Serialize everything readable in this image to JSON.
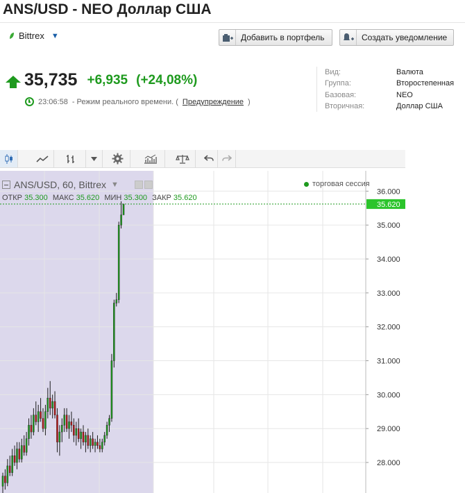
{
  "header": {
    "title": "ANS/USD - NEO Доллар США",
    "exchange": "Bittrex"
  },
  "actions": {
    "add_portfolio": "Добавить в портфель",
    "create_alert": "Создать уведомление"
  },
  "quote": {
    "price": "35,735",
    "change": "+6,935",
    "change_pct": "(+24,08%)",
    "time": "23:06:58",
    "mode_text": "- Режим реального времени. (",
    "warning_link": "Предупреждение",
    "mode_close": ")"
  },
  "info": [
    {
      "key": "Вид:",
      "value": "Валюта"
    },
    {
      "key": "Группа:",
      "value": "Второстепенная"
    },
    {
      "key": "Базовая:",
      "value": "NEO"
    },
    {
      "key": "Вторичная:",
      "value": "Доллар США"
    }
  ],
  "chart_header": {
    "symbol": "ANS/USD, 60, Bittrex",
    "session": "торговая сессия",
    "open_label": "ОТКР",
    "open": "35.300",
    "high_label": "МАКС",
    "high": "35.620",
    "low_label": "МИН",
    "low": "35.300",
    "close_label": "ЗАКР",
    "close": "35.620"
  },
  "colors": {
    "up": "#1e9a1e",
    "down": "#b81818",
    "shade": "#dcd8ec",
    "price_tag": "#2bc42b"
  },
  "chart_data": {
    "type": "candlestick",
    "ylim": [
      27.1,
      36.6
    ],
    "y_ticks": [
      "36.000",
      "35.000",
      "34.000",
      "33.000",
      "32.000",
      "31.000",
      "30.000",
      "29.000",
      "28.000"
    ],
    "y_tick_values": [
      36,
      35,
      34,
      33,
      32,
      31,
      30,
      29,
      28
    ],
    "last_price_label": "35.620",
    "last_price": 35.62,
    "grid": true,
    "bars": [
      [
        27.3,
        27.7,
        26.9,
        27.6
      ],
      [
        27.6,
        27.8,
        27.2,
        27.4
      ],
      [
        27.4,
        28.1,
        27.3,
        27.9
      ],
      [
        27.9,
        28.2,
        27.6,
        27.7
      ],
      [
        27.7,
        28.4,
        27.6,
        28.2
      ],
      [
        28.2,
        28.5,
        27.9,
        28.0
      ],
      [
        28.0,
        28.6,
        27.8,
        28.4
      ],
      [
        28.4,
        28.6,
        28.0,
        28.1
      ],
      [
        28.1,
        28.7,
        28.0,
        28.5
      ],
      [
        28.5,
        28.8,
        28.2,
        28.3
      ],
      [
        28.3,
        28.9,
        28.2,
        28.7
      ],
      [
        28.7,
        29.3,
        28.5,
        29.1
      ],
      [
        29.1,
        29.4,
        28.7,
        28.9
      ],
      [
        28.9,
        29.6,
        28.8,
        29.4
      ],
      [
        29.4,
        29.8,
        29.1,
        29.2
      ],
      [
        29.2,
        29.7,
        28.9,
        29.5
      ],
      [
        29.5,
        29.9,
        29.2,
        29.3
      ],
      [
        29.3,
        29.6,
        28.9,
        29.0
      ],
      [
        29.0,
        29.7,
        28.8,
        29.5
      ],
      [
        29.5,
        30.2,
        29.3,
        29.9
      ],
      [
        29.9,
        30.4,
        29.4,
        29.6
      ],
      [
        29.6,
        30.0,
        29.3,
        29.8
      ],
      [
        29.8,
        30.1,
        29.3,
        29.4
      ],
      [
        29.4,
        29.6,
        28.3,
        28.6
      ],
      [
        28.6,
        29.1,
        28.2,
        28.9
      ],
      [
        28.9,
        29.3,
        28.6,
        29.1
      ],
      [
        29.1,
        29.6,
        28.9,
        29.4
      ],
      [
        29.4,
        29.6,
        28.9,
        29.0
      ],
      [
        29.0,
        29.4,
        28.7,
        29.2
      ],
      [
        29.2,
        29.5,
        28.9,
        29.1
      ],
      [
        29.1,
        29.3,
        28.6,
        28.8
      ],
      [
        28.8,
        29.2,
        28.5,
        29.0
      ],
      [
        29.0,
        29.3,
        28.6,
        28.7
      ],
      [
        28.7,
        29.0,
        28.4,
        28.9
      ],
      [
        28.9,
        29.1,
        28.5,
        28.6
      ],
      [
        28.6,
        28.9,
        28.3,
        28.8
      ],
      [
        28.8,
        29.0,
        28.4,
        28.5
      ],
      [
        28.5,
        28.8,
        28.3,
        28.7
      ],
      [
        28.7,
        28.9,
        28.4,
        28.5
      ],
      [
        28.5,
        28.7,
        28.3,
        28.6
      ],
      [
        28.6,
        28.8,
        28.4,
        28.5
      ],
      [
        28.5,
        28.7,
        28.3,
        28.4
      ],
      [
        28.4,
        28.7,
        28.3,
        28.6
      ],
      [
        28.6,
        28.9,
        28.5,
        28.8
      ],
      [
        28.8,
        29.2,
        28.7,
        29.1
      ],
      [
        29.1,
        29.4,
        28.9,
        29.3
      ],
      [
        29.3,
        31.2,
        29.2,
        31.0
      ],
      [
        31.0,
        32.8,
        30.8,
        32.7
      ],
      [
        32.7,
        33.0,
        32.6,
        32.8
      ],
      [
        32.8,
        35.1,
        32.7,
        35.0
      ],
      [
        35.0,
        35.7,
        34.9,
        35.3
      ],
      [
        35.3,
        35.62,
        35.3,
        35.62
      ]
    ]
  },
  "toolbar": {
    "items": [
      "candles-icon",
      "line-chart-icon",
      "bars-icon",
      "dropdown-icon",
      "settings-icon",
      "indicators-icon",
      "compare-icon",
      "undo-icon",
      "redo-icon"
    ]
  }
}
